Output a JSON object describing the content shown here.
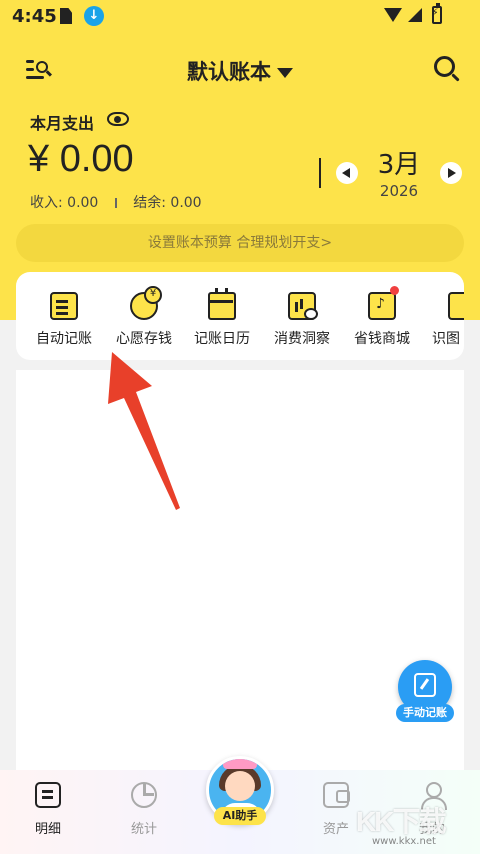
{
  "status_bar": {
    "time": "4:45"
  },
  "header": {
    "book_title": "默认账本"
  },
  "summary": {
    "label": "本月支出",
    "amount": "¥ 0.00",
    "income_label": "收入:",
    "income_value": "0.00",
    "balance_label": "结余:",
    "balance_value": "0.00",
    "month": "3月",
    "year": "2026"
  },
  "budget_banner": "设置账本预算 合理规划开支>",
  "features": [
    {
      "label": "自动记账",
      "icon": "auto-record-icon"
    },
    {
      "label": "心愿存钱",
      "icon": "piggy-bank-icon"
    },
    {
      "label": "记账日历",
      "icon": "calendar-icon"
    },
    {
      "label": "消费洞察",
      "icon": "insight-chart-icon"
    },
    {
      "label": "省钱商城",
      "icon": "shopping-bag-icon"
    },
    {
      "label": "识图",
      "icon": "scan-icon"
    }
  ],
  "floating_button": {
    "label": "手动记账"
  },
  "bottom_nav": {
    "tabs": [
      {
        "label": "明细",
        "icon": "list-icon",
        "active": true
      },
      {
        "label": "统计",
        "icon": "pie-chart-icon",
        "active": false
      },
      {
        "label": "资产",
        "icon": "wallet-icon",
        "active": false
      },
      {
        "label": "我的",
        "icon": "user-icon",
        "active": false
      }
    ],
    "ai_label": "AI助手"
  },
  "watermark": {
    "brand": "KK下载",
    "url": "www.kkx.net"
  },
  "colors": {
    "brand_yellow": "#fde34a",
    "accent_blue": "#2a9df4",
    "annotation_red": "#e8402a"
  }
}
